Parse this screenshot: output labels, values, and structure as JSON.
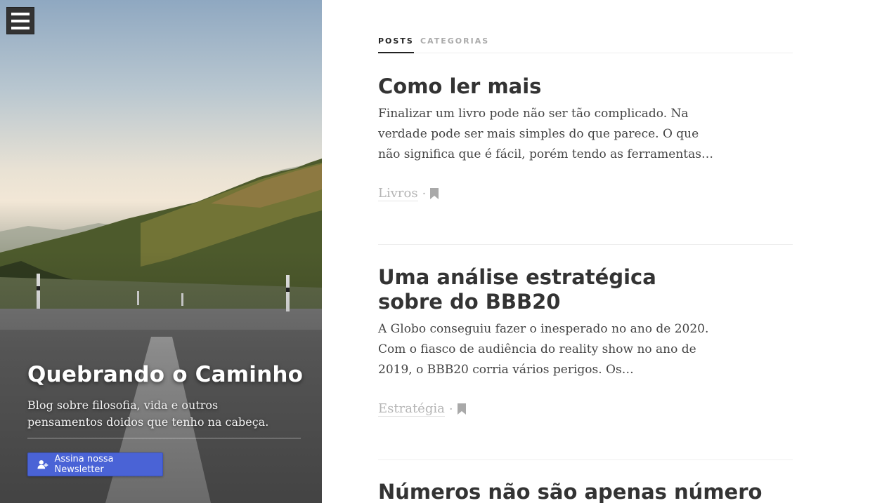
{
  "sidebar": {
    "title": "Quebrando o Caminho",
    "description": "Blog sobre filosofia, vida e outros pensamentos doidos que tenho na cabeça.",
    "newsletter_label": "Assina nossa Newsletter",
    "menu_icon": "hamburger-icon",
    "newsletter_icon": "user-plus-icon"
  },
  "tabs": [
    {
      "label": "POSTS",
      "active": true
    },
    {
      "label": "CATEGORIAS",
      "active": false
    }
  ],
  "posts": [
    {
      "title": "Como ler mais",
      "excerpt": "Finalizar um livro pode não ser tão complicado. Na verdade pode ser mais simples do que parece. O que não significa que é fácil, porém tendo as ferramentas…",
      "category": "Livros",
      "separator": "·"
    },
    {
      "title": "Uma análise estratégica sobre do BBB20",
      "excerpt": "A Globo conseguiu fazer o inesperado no ano de 2020. Com o fiasco de audiência do reality show no ano de 2019, o BBB20 corria vários perigos. Os…",
      "category": "Estratégia",
      "separator": "·"
    },
    {
      "title": "Números não são apenas número"
    }
  ],
  "colors": {
    "accent": "#4a63d6",
    "text": "#333333",
    "muted": "#b5b5b5"
  }
}
